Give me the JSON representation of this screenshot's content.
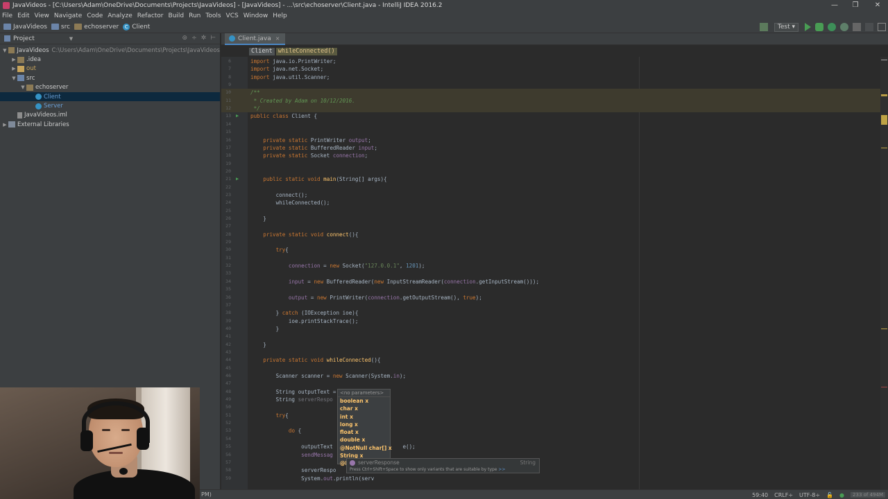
{
  "window": {
    "title": "JavaVideos - [C:\\Users\\Adam\\OneDrive\\Documents\\Projects\\JavaVideos] - [JavaVideos] - ...\\src\\echoserver\\Client.java - IntelliJ IDEA 2016.2"
  },
  "menu": [
    "File",
    "Edit",
    "View",
    "Navigate",
    "Code",
    "Analyze",
    "Refactor",
    "Build",
    "Run",
    "Tools",
    "VCS",
    "Window",
    "Help"
  ],
  "navbar": {
    "crumbs": [
      "JavaVideos",
      "src",
      "echoserver",
      "Client"
    ],
    "run_config": "Test"
  },
  "sidebar": {
    "header": "Project",
    "tree": [
      {
        "label": "JavaVideos",
        "path": "C:\\Users\\Adam\\OneDrive\\Documents\\Projects\\JavaVideos",
        "indent": 0,
        "toggle": "▼",
        "icon": "folder-icon"
      },
      {
        "label": ".idea",
        "path": "",
        "indent": 1,
        "toggle": "▶",
        "icon": "folder-icon"
      },
      {
        "label": "out",
        "path": "",
        "indent": 1,
        "toggle": "▶",
        "icon": "folder-icon",
        "color": "orange"
      },
      {
        "label": "src",
        "path": "",
        "indent": 1,
        "toggle": "▼",
        "icon": "source-folder-icon"
      },
      {
        "label": "echoserver",
        "path": "",
        "indent": 2,
        "toggle": "▼",
        "icon": "package-icon"
      },
      {
        "label": "Client",
        "path": "",
        "indent": 3,
        "toggle": "",
        "icon": "class-icon",
        "selected": true
      },
      {
        "label": "Server",
        "path": "",
        "indent": 3,
        "toggle": "",
        "icon": "class-icon"
      },
      {
        "label": "JavaVideos.iml",
        "path": "",
        "indent": 1,
        "toggle": "",
        "icon": "file-icon"
      },
      {
        "label": "External Libraries",
        "path": "",
        "indent": 0,
        "toggle": "▶",
        "icon": "library-icon"
      }
    ]
  },
  "editor": {
    "tab": "Client.java",
    "breadcrumbs": [
      "Client",
      "whileConnected()"
    ],
    "lines": [
      {
        "n": "6",
        "html": "<span class='kw'>import</span> java.io.PrintWriter;"
      },
      {
        "n": "7",
        "html": "<span class='kw'>import</span> java.net.Socket;"
      },
      {
        "n": "8",
        "html": "<span class='kw'>import</span> java.util.Scanner;"
      },
      {
        "n": "9",
        "html": ""
      },
      {
        "n": "10",
        "html": "<span class='cmt'>/**</span>",
        "hl": true
      },
      {
        "n": "11",
        "html": "<span class='cmt'> * Created by Adam on 10/12/2016.</span>",
        "hl": true
      },
      {
        "n": "12",
        "html": "<span class='cmt'> */</span>",
        "hl": true
      },
      {
        "n": "13",
        "html": "<span class='kw'>public class</span> Client {",
        "run": true
      },
      {
        "n": "14",
        "html": ""
      },
      {
        "n": "15",
        "html": ""
      },
      {
        "n": "16",
        "html": "    <span class='kw'>private static</span> PrintWriter <span class='fld'>output</span>;"
      },
      {
        "n": "17",
        "html": "    <span class='kw'>private static</span> BufferedReader <span class='fld'>input</span>;"
      },
      {
        "n": "18",
        "html": "    <span class='kw'>private static</span> Socket <span class='fld'>connection</span>;"
      },
      {
        "n": "19",
        "html": ""
      },
      {
        "n": "20",
        "html": ""
      },
      {
        "n": "21",
        "html": "    <span class='kw'>public static void</span> <span class='fn'>main</span>(String[] args){",
        "run": true
      },
      {
        "n": "22",
        "html": ""
      },
      {
        "n": "23",
        "html": "        connect();"
      },
      {
        "n": "24",
        "html": "        whileConnected();"
      },
      {
        "n": "25",
        "html": ""
      },
      {
        "n": "26",
        "html": "    }"
      },
      {
        "n": "27",
        "html": ""
      },
      {
        "n": "28",
        "html": "    <span class='kw'>private static void</span> <span class='fn'>connect</span>(){"
      },
      {
        "n": "29",
        "html": ""
      },
      {
        "n": "30",
        "html": "        <span class='kw'>try</span>{"
      },
      {
        "n": "31",
        "html": ""
      },
      {
        "n": "32",
        "html": "            <span class='fld'>connection</span> = <span class='kw'>new</span> Socket(<span class='str'>\"127.0.0.1\"</span>, <span class='num'>1201</span>);"
      },
      {
        "n": "33",
        "html": ""
      },
      {
        "n": "34",
        "html": "            <span class='fld'>input</span> = <span class='kw'>new</span> BufferedReader(<span class='kw'>new</span> InputStreamReader(<span class='fld'>connection</span>.getInputStream()));"
      },
      {
        "n": "35",
        "html": ""
      },
      {
        "n": "36",
        "html": "            <span class='fld'>output</span> = <span class='kw'>new</span> PrintWriter(<span class='fld'>connection</span>.getOutputStream(), <span class='kw'>true</span>);"
      },
      {
        "n": "37",
        "html": ""
      },
      {
        "n": "38",
        "html": "        } <span class='kw'>catch</span> (IOException ioe){"
      },
      {
        "n": "39",
        "html": "            ioe.printStackTrace();"
      },
      {
        "n": "40",
        "html": "        }"
      },
      {
        "n": "41",
        "html": ""
      },
      {
        "n": "42",
        "html": "    }"
      },
      {
        "n": "43",
        "html": ""
      },
      {
        "n": "44",
        "html": "    <span class='kw'>private static void</span> <span class='fn'>whileConnected</span>(){"
      },
      {
        "n": "45",
        "html": ""
      },
      {
        "n": "46",
        "html": "        Scanner scanner = <span class='kw'>new</span> Scanner(System.<span class='fld'>in</span>);"
      },
      {
        "n": "47",
        "html": ""
      },
      {
        "n": "48",
        "html": "        String outputText ="
      },
      {
        "n": "49",
        "html": "        String <span class='unused'>serverRespo</span>"
      },
      {
        "n": "50",
        "html": ""
      },
      {
        "n": "51",
        "html": "        <span class='kw'>try</span>{"
      },
      {
        "n": "52",
        "html": ""
      },
      {
        "n": "53",
        "html": "            <span class='kw'>do</span> {"
      },
      {
        "n": "54",
        "html": ""
      },
      {
        "n": "55",
        "html": "                outputText                      e();"
      },
      {
        "n": "56",
        "html": "                <span class='fld'>sendMessag</span>"
      },
      {
        "n": "57",
        "html": ""
      },
      {
        "n": "58",
        "html": "                serverRespo"
      },
      {
        "n": "59",
        "html": "                System.<span class='fld'>out</span>.println(serv"
      }
    ]
  },
  "completion": {
    "header": "<no parameters>",
    "items": [
      "boolean x",
      "char x",
      "int x",
      "long x",
      "float x",
      "double x",
      "@NotNull char[] x",
      "String x",
      "@N"
    ]
  },
  "hint": {
    "name": "serverResponse",
    "type": "String",
    "text": "Press Ctrl+Shift+Space to show only variants that are suitable by type",
    "link": ">>"
  },
  "status": {
    "left": "PM)",
    "position": "59:40",
    "line_sep": "CRLF÷",
    "encoding": "UTF-8÷",
    "memory": "233 of 494M"
  }
}
